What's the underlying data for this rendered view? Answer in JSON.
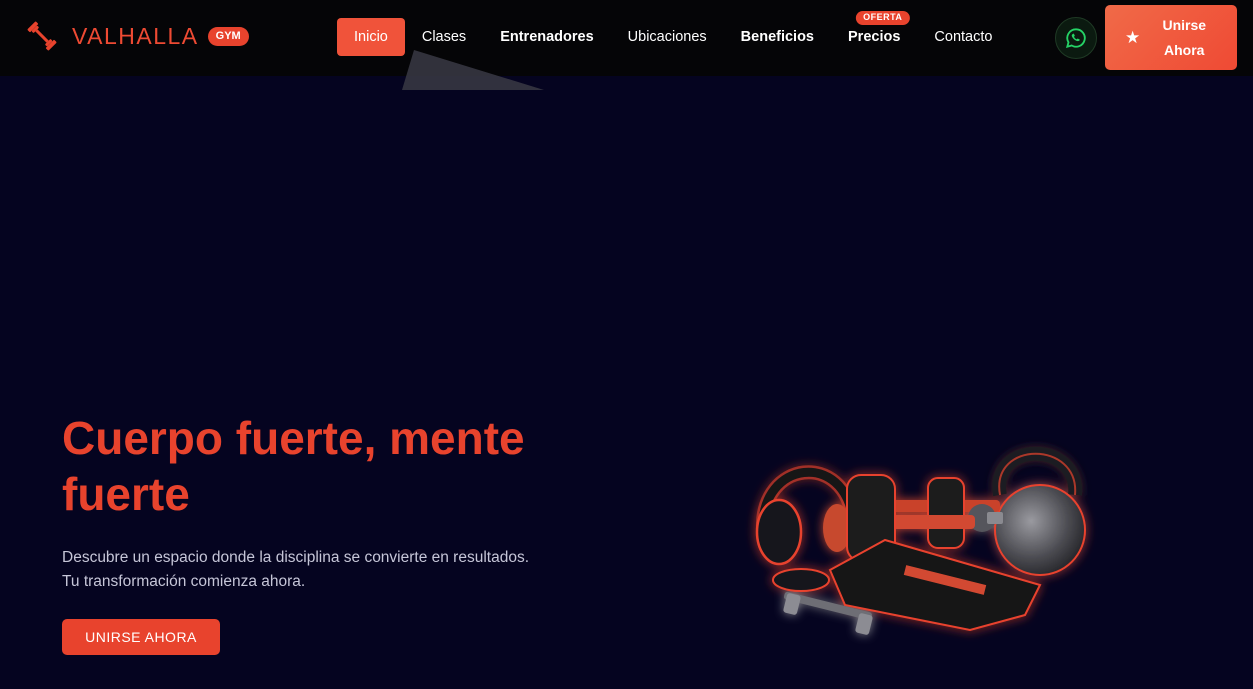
{
  "brand": {
    "name": "VALHALLA",
    "badge": "GYM",
    "icon": "dumbbell-icon",
    "accent_color": "#e8432d"
  },
  "nav": {
    "items": [
      {
        "label": "Inicio",
        "active": true
      },
      {
        "label": "Clases"
      },
      {
        "label": "Entrenadores"
      },
      {
        "label": "Ubicaciones"
      },
      {
        "label": "Beneficios"
      },
      {
        "label": "Precios",
        "badge": "OFERTA"
      },
      {
        "label": "Contacto"
      }
    ],
    "whatsapp_icon": "whatsapp-icon",
    "join": {
      "line1": "Unirse",
      "line2": "Ahora",
      "icon": "star-icon"
    }
  },
  "hero": {
    "title": "Cuerpo fuerte, mente fuerte",
    "description_line1": "Descubre un espacio donde la disciplina se convierte en resultados.",
    "description_line2": "Tu transformación comienza ahora.",
    "cta": "UNIRSE AHORA",
    "image": "gym-equipment-image"
  },
  "colors": {
    "background": "#050420",
    "navbar": "#050507",
    "accent": "#e8432d"
  }
}
